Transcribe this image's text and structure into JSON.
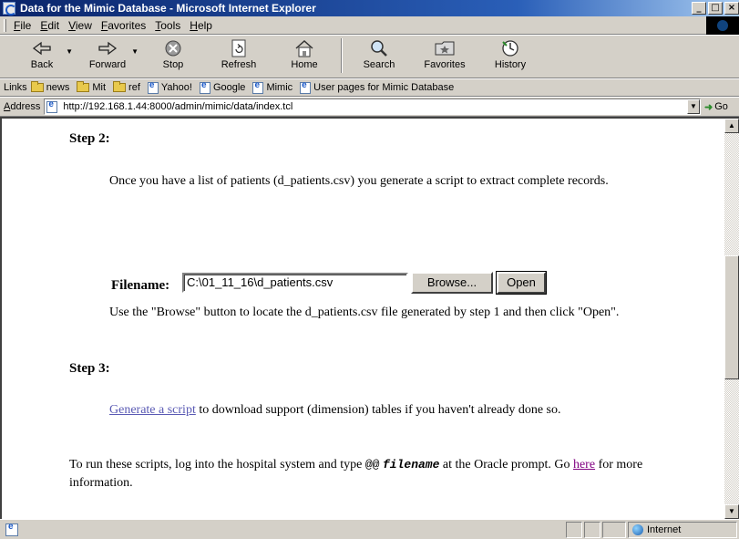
{
  "window": {
    "title": "Data for the Mimic Database - Microsoft Internet Explorer",
    "buttons": [
      "_",
      "□",
      "×"
    ]
  },
  "menu": [
    "File",
    "Edit",
    "View",
    "Favorites",
    "Tools",
    "Help"
  ],
  "toolbar": {
    "back": "Back",
    "forward": "Forward",
    "stop": "Stop",
    "refresh": "Refresh",
    "home": "Home",
    "search": "Search",
    "favorites": "Favorites",
    "history": "History"
  },
  "links": {
    "label": "Links",
    "items": [
      "news",
      "Mit",
      "ref",
      "Yahoo!",
      "Google",
      "Mimic",
      "User pages for Mimic Database"
    ]
  },
  "address": {
    "label": "Address",
    "url": "http://192.168.1.44:8000/admin/mimic/data/index.tcl",
    "go": "Go"
  },
  "content": {
    "step2_heading": "Step 2:",
    "step2_text": "Once you have a list of patients (d_patients.csv) you generate a script to extract complete records.",
    "filename_label": "Filename:",
    "filename_value": "C:\\01_11_16\\d_patients.csv",
    "browse_label": "Browse...",
    "open_label": "Open",
    "browse_help": "Use the \"Browse\" button to locate the d_patients.csv file generated by step 1 and then click \"Open\".",
    "step3_heading": "Step 3:",
    "generate_link": "Generate a script",
    "step3_text": " to download support (dimension) tables if you haven't already done so.",
    "final_text_1": "To run these scripts, log into the hospital system and type ",
    "final_cmd": "@@",
    "final_arg": "filename",
    "final_text_2": " at the Oracle prompt. Go ",
    "here_link": "here",
    "final_text_3": " for more information."
  },
  "status": {
    "zone": "Internet"
  }
}
